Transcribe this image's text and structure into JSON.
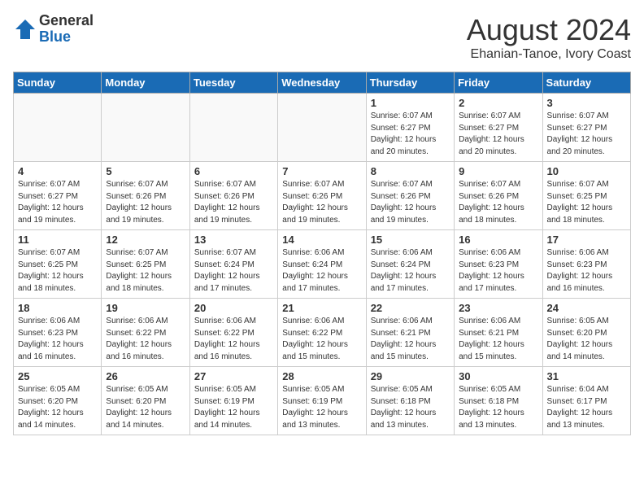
{
  "header": {
    "logo_general": "General",
    "logo_blue": "Blue",
    "month_title": "August 2024",
    "location": "Ehanian-Tanoe, Ivory Coast"
  },
  "days_of_week": [
    "Sunday",
    "Monday",
    "Tuesday",
    "Wednesday",
    "Thursday",
    "Friday",
    "Saturday"
  ],
  "weeks": [
    [
      {
        "day": "",
        "info": ""
      },
      {
        "day": "",
        "info": ""
      },
      {
        "day": "",
        "info": ""
      },
      {
        "day": "",
        "info": ""
      },
      {
        "day": "1",
        "info": "Sunrise: 6:07 AM\nSunset: 6:27 PM\nDaylight: 12 hours\nand 20 minutes."
      },
      {
        "day": "2",
        "info": "Sunrise: 6:07 AM\nSunset: 6:27 PM\nDaylight: 12 hours\nand 20 minutes."
      },
      {
        "day": "3",
        "info": "Sunrise: 6:07 AM\nSunset: 6:27 PM\nDaylight: 12 hours\nand 20 minutes."
      }
    ],
    [
      {
        "day": "4",
        "info": "Sunrise: 6:07 AM\nSunset: 6:27 PM\nDaylight: 12 hours\nand 19 minutes."
      },
      {
        "day": "5",
        "info": "Sunrise: 6:07 AM\nSunset: 6:26 PM\nDaylight: 12 hours\nand 19 minutes."
      },
      {
        "day": "6",
        "info": "Sunrise: 6:07 AM\nSunset: 6:26 PM\nDaylight: 12 hours\nand 19 minutes."
      },
      {
        "day": "7",
        "info": "Sunrise: 6:07 AM\nSunset: 6:26 PM\nDaylight: 12 hours\nand 19 minutes."
      },
      {
        "day": "8",
        "info": "Sunrise: 6:07 AM\nSunset: 6:26 PM\nDaylight: 12 hours\nand 19 minutes."
      },
      {
        "day": "9",
        "info": "Sunrise: 6:07 AM\nSunset: 6:26 PM\nDaylight: 12 hours\nand 18 minutes."
      },
      {
        "day": "10",
        "info": "Sunrise: 6:07 AM\nSunset: 6:25 PM\nDaylight: 12 hours\nand 18 minutes."
      }
    ],
    [
      {
        "day": "11",
        "info": "Sunrise: 6:07 AM\nSunset: 6:25 PM\nDaylight: 12 hours\nand 18 minutes."
      },
      {
        "day": "12",
        "info": "Sunrise: 6:07 AM\nSunset: 6:25 PM\nDaylight: 12 hours\nand 18 minutes."
      },
      {
        "day": "13",
        "info": "Sunrise: 6:07 AM\nSunset: 6:24 PM\nDaylight: 12 hours\nand 17 minutes."
      },
      {
        "day": "14",
        "info": "Sunrise: 6:06 AM\nSunset: 6:24 PM\nDaylight: 12 hours\nand 17 minutes."
      },
      {
        "day": "15",
        "info": "Sunrise: 6:06 AM\nSunset: 6:24 PM\nDaylight: 12 hours\nand 17 minutes."
      },
      {
        "day": "16",
        "info": "Sunrise: 6:06 AM\nSunset: 6:23 PM\nDaylight: 12 hours\nand 17 minutes."
      },
      {
        "day": "17",
        "info": "Sunrise: 6:06 AM\nSunset: 6:23 PM\nDaylight: 12 hours\nand 16 minutes."
      }
    ],
    [
      {
        "day": "18",
        "info": "Sunrise: 6:06 AM\nSunset: 6:23 PM\nDaylight: 12 hours\nand 16 minutes."
      },
      {
        "day": "19",
        "info": "Sunrise: 6:06 AM\nSunset: 6:22 PM\nDaylight: 12 hours\nand 16 minutes."
      },
      {
        "day": "20",
        "info": "Sunrise: 6:06 AM\nSunset: 6:22 PM\nDaylight: 12 hours\nand 16 minutes."
      },
      {
        "day": "21",
        "info": "Sunrise: 6:06 AM\nSunset: 6:22 PM\nDaylight: 12 hours\nand 15 minutes."
      },
      {
        "day": "22",
        "info": "Sunrise: 6:06 AM\nSunset: 6:21 PM\nDaylight: 12 hours\nand 15 minutes."
      },
      {
        "day": "23",
        "info": "Sunrise: 6:06 AM\nSunset: 6:21 PM\nDaylight: 12 hours\nand 15 minutes."
      },
      {
        "day": "24",
        "info": "Sunrise: 6:05 AM\nSunset: 6:20 PM\nDaylight: 12 hours\nand 14 minutes."
      }
    ],
    [
      {
        "day": "25",
        "info": "Sunrise: 6:05 AM\nSunset: 6:20 PM\nDaylight: 12 hours\nand 14 minutes."
      },
      {
        "day": "26",
        "info": "Sunrise: 6:05 AM\nSunset: 6:20 PM\nDaylight: 12 hours\nand 14 minutes."
      },
      {
        "day": "27",
        "info": "Sunrise: 6:05 AM\nSunset: 6:19 PM\nDaylight: 12 hours\nand 14 minutes."
      },
      {
        "day": "28",
        "info": "Sunrise: 6:05 AM\nSunset: 6:19 PM\nDaylight: 12 hours\nand 13 minutes."
      },
      {
        "day": "29",
        "info": "Sunrise: 6:05 AM\nSunset: 6:18 PM\nDaylight: 12 hours\nand 13 minutes."
      },
      {
        "day": "30",
        "info": "Sunrise: 6:05 AM\nSunset: 6:18 PM\nDaylight: 12 hours\nand 13 minutes."
      },
      {
        "day": "31",
        "info": "Sunrise: 6:04 AM\nSunset: 6:17 PM\nDaylight: 12 hours\nand 13 minutes."
      }
    ]
  ]
}
